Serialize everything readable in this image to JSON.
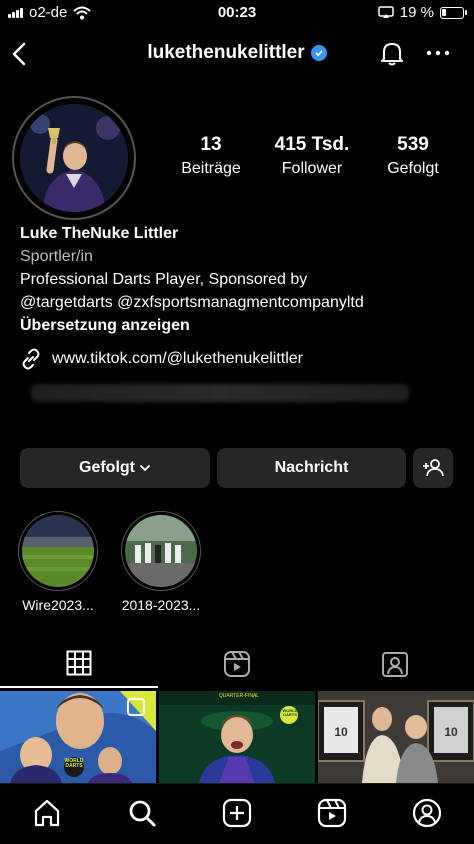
{
  "status_bar": {
    "carrier": "o2-de",
    "time": "00:23",
    "battery": "19 %"
  },
  "header": {
    "username": "lukethenukelittler",
    "back_icon": "chevron-left-icon",
    "bell_icon": "bell-icon",
    "more_icon": "more-icon"
  },
  "profile": {
    "stats": [
      {
        "value": "13",
        "label": "Beiträge"
      },
      {
        "value": "415 Tsd.",
        "label": "Follower"
      },
      {
        "value": "539",
        "label": "Gefolgt"
      }
    ],
    "name": "Luke TheNuke Littler",
    "category": "Sportler/in",
    "bio_line1": "Professional Darts Player, Sponsored by",
    "bio_line2": "@targetdarts @zxfsportsmanagmentcompanyltd",
    "translate": "Übersetzung anzeigen",
    "link": "www.tiktok.com/@lukethenukelittler"
  },
  "actions": {
    "following": "Gefolgt",
    "message": "Nachricht"
  },
  "highlights": [
    {
      "label": "Wire2023..."
    },
    {
      "label": "2018-2023..."
    }
  ],
  "grid_texts": {
    "post1_badge": "WORLD DARTS",
    "post2_header": "QUARTER-FINAL",
    "post2_badge": "WORLD DARTS",
    "post3_jersey1": "10",
    "post3_jersey2": "10"
  },
  "colors": {
    "background": "#000000",
    "button": "#262626",
    "verified": "#3897f0"
  }
}
